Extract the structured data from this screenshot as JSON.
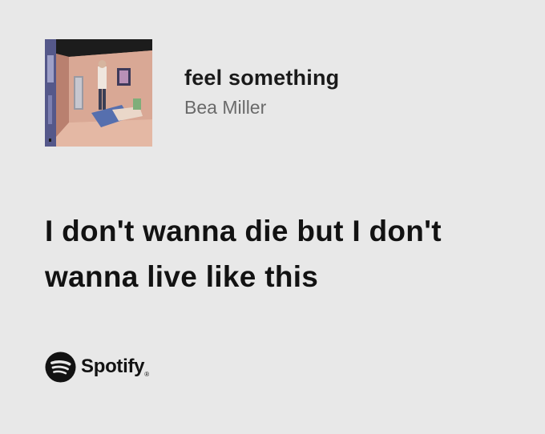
{
  "track": {
    "title": "feel something",
    "artist": "Bea Miller",
    "album_art_icon": "album-cover-image"
  },
  "lyric": {
    "line1": "I don't wanna die but I don't",
    "line2": "wanna live like this"
  },
  "brand": {
    "name": "Spotify",
    "icon": "spotify-logo-icon",
    "registered_mark": "®"
  },
  "colors": {
    "background": "#e8e8e8",
    "text_primary": "#121212",
    "text_secondary": "#6a6a6a"
  }
}
